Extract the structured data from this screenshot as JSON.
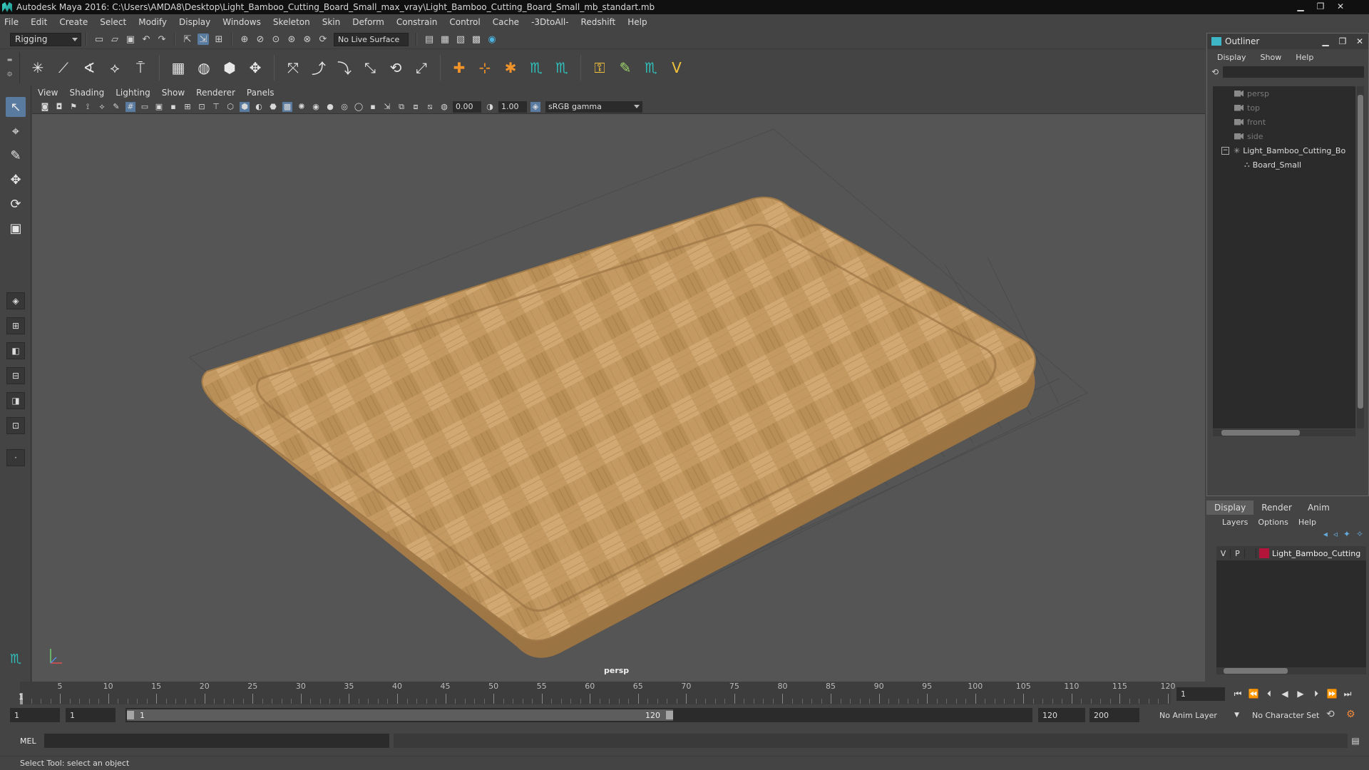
{
  "window": {
    "title": "Autodesk Maya 2016: C:\\Users\\AMDA8\\Desktop\\Light_Bamboo_Cutting_Board_Small_max_vray\\Light_Bamboo_Cutting_Board_Small_mb_standart.mb",
    "minimize": "▁",
    "maximize": "❐",
    "close": "✕"
  },
  "menubar": [
    "File",
    "Edit",
    "Create",
    "Select",
    "Modify",
    "Display",
    "Windows",
    "Skeleton",
    "Skin",
    "Deform",
    "Constrain",
    "Control",
    "Cache",
    "-3DtoAll-",
    "Redshift",
    "Help"
  ],
  "statusline": {
    "mode": "Rigging",
    "live_surface": "No Live Surface"
  },
  "viewport": {
    "menu": [
      "View",
      "Shading",
      "Lighting",
      "Show",
      "Renderer",
      "Panels"
    ],
    "exposure": "0.00",
    "gamma_value": "1.00",
    "color_space": "sRGB gamma",
    "camera": "persp"
  },
  "outliner": {
    "title": "Outliner",
    "minimize": "▁",
    "maximize": "❐",
    "close": "✕",
    "menu": [
      "Display",
      "Show",
      "Help"
    ],
    "items": [
      {
        "label": "persp"
      },
      {
        "label": "top"
      },
      {
        "label": "front"
      },
      {
        "label": "side"
      },
      {
        "label": "Light_Bamboo_Cutting_Bo"
      },
      {
        "label": "Board_Small"
      }
    ]
  },
  "layer_editor": {
    "tabs": [
      "Display",
      "Render",
      "Anim"
    ],
    "menu": [
      "Layers",
      "Options",
      "Help"
    ],
    "layer": {
      "visible": "V",
      "playback": "P",
      "name": "Light_Bamboo_Cutting",
      "color": "#b3143a"
    }
  },
  "timeline": {
    "ticks": [
      "5",
      "10",
      "15",
      "20",
      "25",
      "30",
      "35",
      "40",
      "45",
      "50",
      "55",
      "60",
      "65",
      "70",
      "75",
      "80",
      "85",
      "90",
      "95",
      "100",
      "105",
      "110",
      "115",
      "120"
    ],
    "current_frame_tick": "1",
    "current_frame": "1"
  },
  "range": {
    "start_time": "1",
    "playback_start": "1",
    "range_start_label": "1",
    "range_end_label": "120",
    "playback_end": "120",
    "end_time": "200",
    "anim_layer": "No Anim Layer",
    "character_set": "No Character Set"
  },
  "command_line": {
    "language": "MEL"
  },
  "help_line": "Select Tool: select an object",
  "colors": {
    "accent": "#5a7ba0",
    "layer_color": "#b3143a",
    "maya_teal": "#2fc1bd"
  }
}
